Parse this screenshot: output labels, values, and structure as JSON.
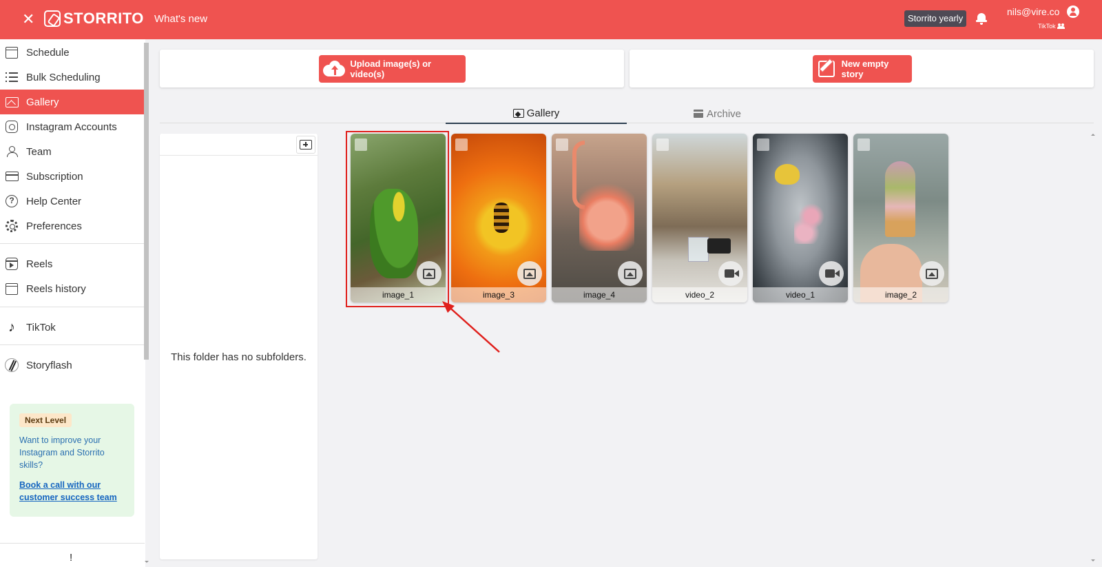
{
  "header": {
    "logo_text": "STORRITO",
    "whats_new": "What's new",
    "plan_badge": "Storrito yearly",
    "user_email": "nils@vire.co",
    "user_sub": "TikTok"
  },
  "sidebar": {
    "items": [
      {
        "label": "Schedule",
        "icon": "calendar-icon"
      },
      {
        "label": "Bulk Scheduling",
        "icon": "list-icon"
      },
      {
        "label": "Gallery",
        "icon": "gallery-icon",
        "active": true
      },
      {
        "label": "Instagram Accounts",
        "icon": "instagram-icon"
      },
      {
        "label": "Team",
        "icon": "team-icon"
      },
      {
        "label": "Subscription",
        "icon": "credit-card-icon"
      },
      {
        "label": "Help Center",
        "icon": "help-icon"
      },
      {
        "label": "Preferences",
        "icon": "gear-icon"
      },
      {
        "label": "Reels",
        "icon": "reels-icon"
      },
      {
        "label": "Reels history",
        "icon": "calendar-icon"
      },
      {
        "label": "TikTok",
        "icon": "tiktok-icon"
      },
      {
        "label": "Storyflash",
        "icon": "storyflash-icon"
      }
    ],
    "promo": {
      "badge": "Next Level",
      "text": "Want to improve your Instagram and Storrito skills?",
      "link": "Book a call with our customer success team"
    },
    "bottom_mark": "!"
  },
  "actions": {
    "upload_label": "Upload image(s) or video(s)",
    "new_story_label": "New empty story"
  },
  "tabs": [
    {
      "label": "Gallery",
      "active": true
    },
    {
      "label": "Archive",
      "active": false
    }
  ],
  "folders": {
    "empty_text": "This folder has no subfolders."
  },
  "media": [
    {
      "name": "image_1",
      "type": "image",
      "selected_highlight": true
    },
    {
      "name": "image_3",
      "type": "image"
    },
    {
      "name": "image_4",
      "type": "image"
    },
    {
      "name": "video_2",
      "type": "video"
    },
    {
      "name": "video_1",
      "type": "video"
    },
    {
      "name": "image_2",
      "type": "image"
    }
  ],
  "colors": {
    "brand": "#ef5350",
    "highlight": "#e0201c"
  }
}
